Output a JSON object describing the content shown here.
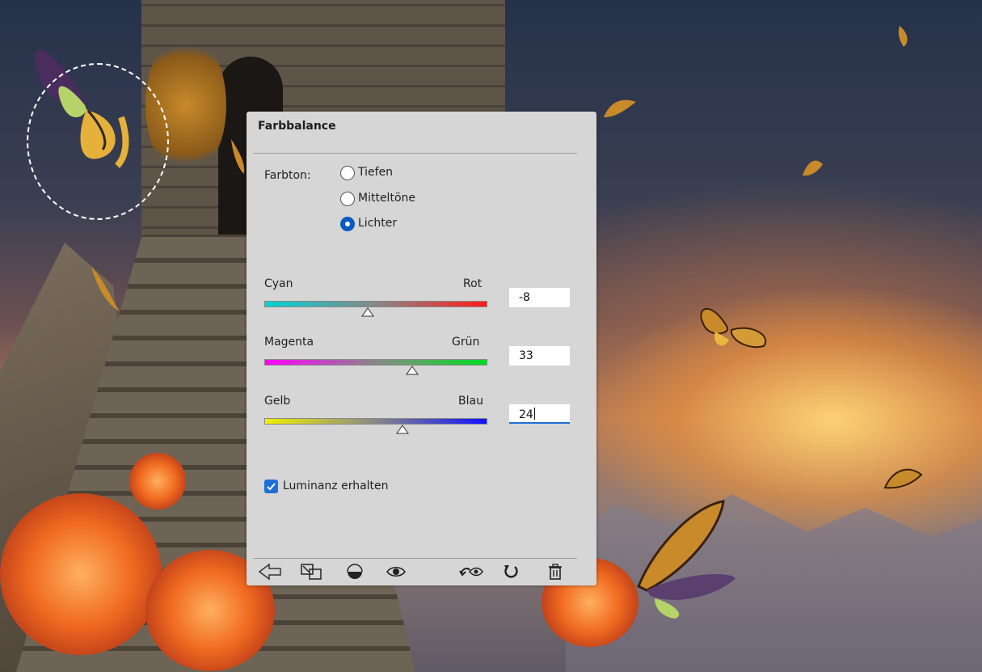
{
  "panel": {
    "title": "Farbbalance",
    "tone_label": "Farbton:",
    "tone_options": [
      {
        "label": "Tiefen",
        "selected": false
      },
      {
        "label": "Mitteltöne",
        "selected": false
      },
      {
        "label": "Lichter",
        "selected": true
      }
    ],
    "sliders": [
      {
        "left": "Cyan",
        "right": "Rot",
        "value": "-8",
        "position": 0.463,
        "active": false,
        "gradient": [
          "#00d4d4",
          "#ff1a1a"
        ]
      },
      {
        "left": "Magenta",
        "right": "Grün",
        "value": "33",
        "position": 0.664,
        "active": false,
        "gradient": [
          "#ff00ff",
          "#00e020"
        ]
      },
      {
        "left": "Gelb",
        "right": "Blau",
        "value": "24",
        "position": 0.62,
        "active": true,
        "gradient": [
          "#f0f000",
          "#1010ff"
        ]
      }
    ],
    "preserve_luminosity": {
      "label": "Luminanz erhalten",
      "checked": true
    },
    "footer_tools": [
      "clip-to-layer-icon",
      "view-previous-state-icon",
      "mask-icon",
      "toggle-visibility-icon",
      "reset-icon",
      "delete-icon"
    ],
    "accent_color": "#1f6fd6"
  }
}
